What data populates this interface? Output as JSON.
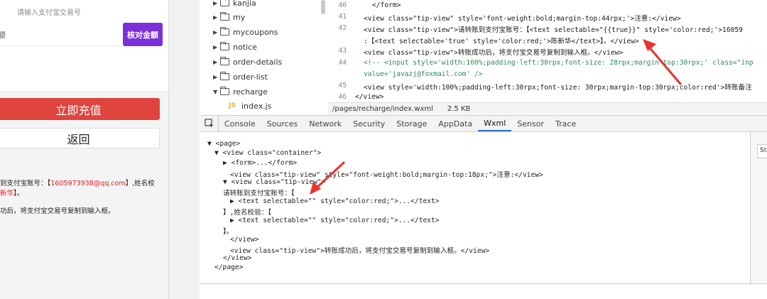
{
  "simulator": {
    "trade_placeholder": "请输入支付宝交易号",
    "amount_label": "额",
    "check_amount_button": "核对金额",
    "recharge_button": "立即充值",
    "back_button": "返回",
    "tip_account_prefix": "到支付宝账号：【",
    "tip_account_value": "1605973938@qq.com",
    "tip_account_suffix": "】,姓名校",
    "tip_name_value": "新华",
    "tip_name_suffix": "】。",
    "tip_copy": "功后，将支付宝交易号复制到输入框。"
  },
  "file_tree": {
    "items": [
      {
        "label": "kanjia",
        "expanded": false
      },
      {
        "label": "my",
        "expanded": false
      },
      {
        "label": "mycoupons",
        "expanded": false
      },
      {
        "label": "notice",
        "expanded": false
      },
      {
        "label": "order-details",
        "expanded": false
      },
      {
        "label": "order-list",
        "expanded": false
      },
      {
        "label": "recharge",
        "expanded": true
      }
    ],
    "file": {
      "badge": "JS",
      "label": "index.js"
    }
  },
  "editor": {
    "lines": [
      {
        "num": "40",
        "text": "</form>"
      },
      {
        "num": "41",
        "text": "<view class=\"tip-view\" style='font-weight:bold;margin-top:44rpx;'>注意:</view>"
      },
      {
        "num": "42",
        "text": "<view class=\"tip-view\">请转账到支付宝账号：【<text selectable=\"{{true}}\" style='color:red;'>16059"
      },
      {
        "num": "",
        "text": ":【<text selectable='true' style='color:red;'>陈新华</text>】。</view>"
      },
      {
        "num": "43",
        "text": "<view class=\"tip-view\">转账成功后，将支付宝交易号复制到输入框。</view>"
      },
      {
        "num": "44",
        "text": "<!-- <input style='width:100%;padding-left:30rpx;font-size: 28rpx;margin-top:30rpx;' class=\"inp"
      },
      {
        "num": "",
        "text": "value='javazj@foxmail.com' />"
      },
      {
        "num": "45",
        "text": "<view style='width:100%;padding-left:30rpx;font-size: 30rpx;margin-top:30rpx;color:red'>转账备注"
      },
      {
        "num": "46",
        "text": "</view>"
      }
    ],
    "status_path": "/pages/recharge/index.wxml",
    "status_size": "2.5 KB"
  },
  "devtools": {
    "tabs": [
      "Console",
      "Sources",
      "Network",
      "Security",
      "Storage",
      "AppData",
      "Wxml",
      "Sensor",
      "Trace"
    ],
    "active_tab": "Wxml",
    "side_tab": "St"
  },
  "wxml": {
    "lines": [
      "▼ <page>",
      "▼ <view class=\"container\">",
      "▶ <form>...</form>",
      "<view class=\"tip-view\" style=\"font-weight:bold;margin-top:18px;\">注意:</view>",
      "▼ <view class=\"tip-view\">",
      "请转账到支付宝账号：【",
      "▶ <text selectable=\"\" style=\"color:red;\">...</text>",
      "】,姓名校验：【",
      "▶ <text selectable=\"\" style=\"color:red;\">...</text>",
      "】。",
      "</view>",
      "<view class=\"tip-view\">转账成功后，将支付宝交易号复制到输入框。</view>",
      "</view>",
      "</page>"
    ]
  },
  "colors": {
    "check_button": "#7b2fd9",
    "recharge_button": "#e0443f",
    "highlight_red": "#e02020",
    "arrow_red": "#e8332a",
    "active_tab": "#2a6fd6"
  }
}
